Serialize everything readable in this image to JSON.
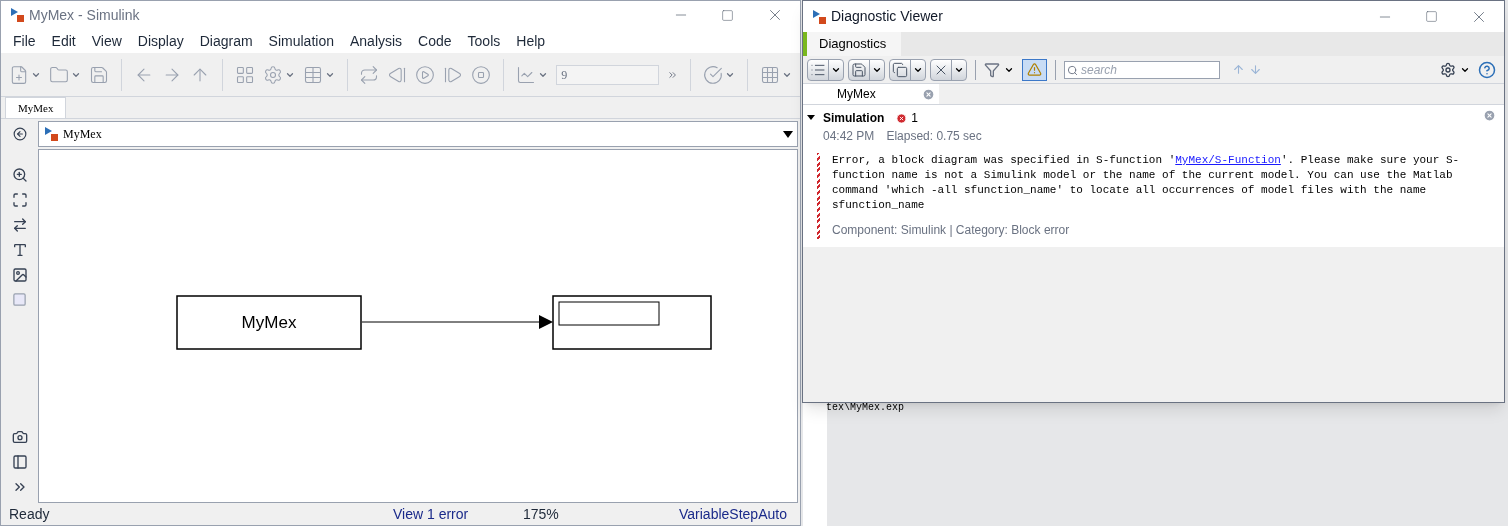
{
  "simulink_window": {
    "title": "MyMex - Simulink",
    "menu": [
      "File",
      "Edit",
      "View",
      "Display",
      "Diagram",
      "Simulation",
      "Analysis",
      "Code",
      "Tools",
      "Help"
    ],
    "stop_time": "9",
    "tabs": [
      {
        "label": "MyMex",
        "selected": true
      }
    ],
    "breadcrumb": "MyMex",
    "diagram": {
      "blocks": [
        {
          "kind": "labeled",
          "label": "MyMex"
        },
        {
          "kind": "display"
        }
      ]
    },
    "status_bar": [
      {
        "kind": "plain",
        "text": "Ready"
      },
      {
        "kind": "link",
        "text": "View 1 error"
      },
      {
        "kind": "plain",
        "text": "175%"
      },
      {
        "kind": "link",
        "text": "VariableStepAuto"
      }
    ]
  },
  "background": {
    "console_line": "tex\\MyMex.exp"
  },
  "diagnostic_viewer": {
    "title": "Diagnostic Viewer",
    "tabs": [
      {
        "label": "Diagnostics",
        "selected": true
      }
    ],
    "warnings_toggle": {
      "selected": true
    },
    "search": {
      "placeholder": "search"
    },
    "model_tab": "MyMex",
    "group": {
      "title": "Simulation",
      "expanded": true,
      "error_count": "1",
      "time": "04:42 PM",
      "elapsed": "Elapsed: 0.75 sec",
      "message_before": "Error, a block diagram was specified in S-function '",
      "message_link": "MyMex/S-Function",
      "message_after": "'. Please make sure your S-function name is not a Simulink model or the name of the current model. You can use the Matlab command 'which -all sfunction_name' to locate all occurrences of model files with the name sfunction_name",
      "footer": "Component:  Simulink | Category:  Block error"
    }
  }
}
